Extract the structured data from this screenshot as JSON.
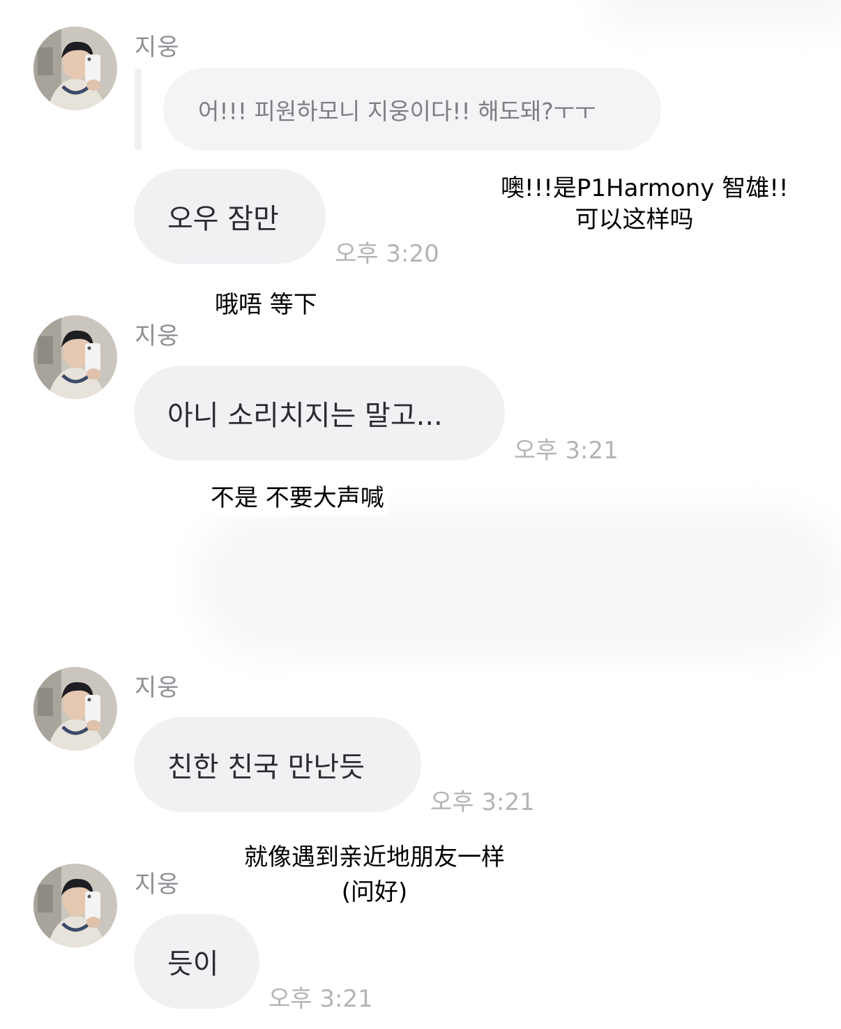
{
  "messages": [
    {
      "sender": "지웅",
      "quote": "어!!! 피원하모니 지웅이다!! 해도돼?ㅜㅜ",
      "text": "오우 잠만",
      "time": "오후 3:20"
    },
    {
      "sender": "지웅",
      "text": "아니 소리치지는 말고...",
      "time": "오후 3:21"
    },
    {
      "sender": "지웅",
      "text": "친한 친국 만난듯",
      "time": "오후 3:21"
    },
    {
      "sender": "지웅",
      "text": "듯이",
      "time": "오후 3:21"
    }
  ],
  "translations": {
    "quote_line1": "噢!!!是P1Harmony 智雄!!",
    "quote_line2": "可以这样吗",
    "msg1": "哦唔 等下",
    "msg2": "不是 不要大声喊",
    "msg3_line1": "就像遇到亲近地朋友一样",
    "msg3_line2": "(问好)"
  },
  "colors": {
    "bubble": "#f1f1f4",
    "sender_text": "#8e8e94",
    "time_text": "#b3b3b8"
  }
}
